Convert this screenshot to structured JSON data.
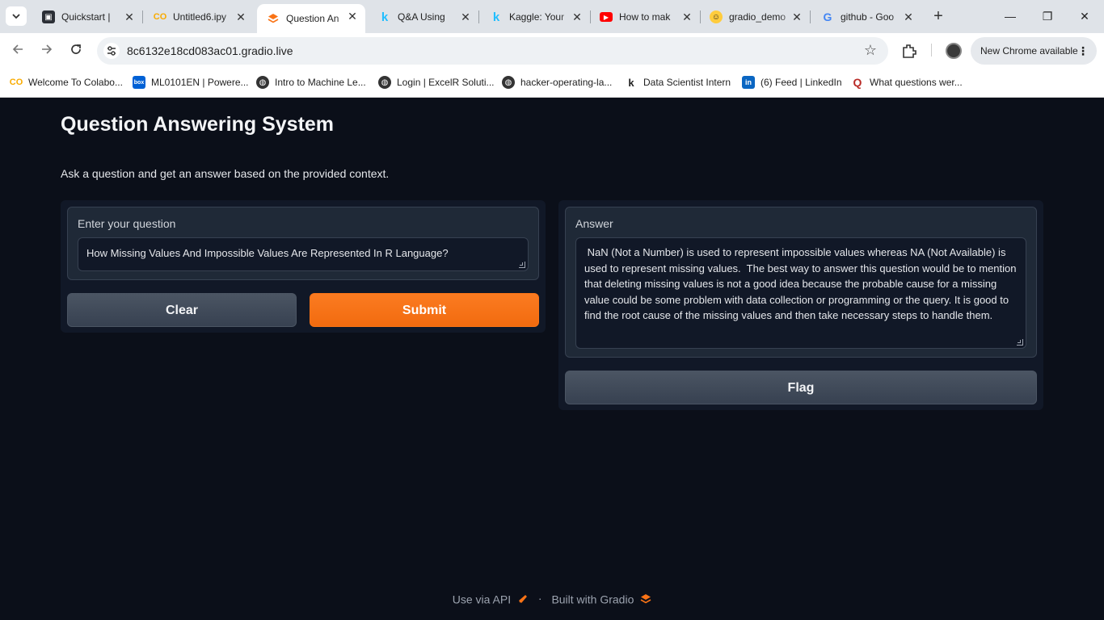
{
  "browser": {
    "tabs": [
      {
        "title": "Quickstart | ",
        "favicon": "colab"
      },
      {
        "title": "Untitled6.ipy",
        "favicon": "colab"
      },
      {
        "title": "Question An",
        "favicon": "gradio",
        "active": true
      },
      {
        "title": "Q&A Using",
        "favicon": "kaggle"
      },
      {
        "title": "Kaggle: Your",
        "favicon": "kaggle"
      },
      {
        "title": "How to mak",
        "favicon": "youtube"
      },
      {
        "title": "gradio_demo",
        "favicon": "huggingface"
      },
      {
        "title": "github - Goo",
        "favicon": "google"
      }
    ],
    "url": "8c6132e18cd083ac01.gradio.live",
    "update_label": "New Chrome available",
    "bookmarks": [
      {
        "label": "Welcome To Colabo...",
        "favicon": "colab"
      },
      {
        "label": "ML0101EN | Powere...",
        "favicon": "box"
      },
      {
        "label": "Intro to Machine Le...",
        "favicon": "globe"
      },
      {
        "label": "Login | ExcelR Soluti...",
        "favicon": "globe"
      },
      {
        "label": "hacker-operating-la...",
        "favicon": "globe"
      },
      {
        "label": "Data Scientist Intern",
        "favicon": "kaggle"
      },
      {
        "label": "(6) Feed | LinkedIn",
        "favicon": "linkedin"
      },
      {
        "label": "What questions wer...",
        "favicon": "quora"
      }
    ]
  },
  "app": {
    "title": "Question Answering System",
    "description": "Ask a question and get an answer based on the provided context.",
    "question_label": "Enter your question",
    "question_value": "How Missing Values And Impossible Values Are Represented In R Language?",
    "clear_label": "Clear",
    "submit_label": "Submit",
    "answer_label": "Answer",
    "answer_value": " NaN (Not a Number) is used to represent impossible values whereas NA (Not Available) is used to represent missing values.  The best way to answer this question would be to mention that deleting missing values is not a good idea because the probable cause for a missing value could be some problem with data collection or programming or the query. It is good to find the root cause of the missing values and then take necessary steps to handle them.",
    "flag_label": "Flag",
    "footer_api": "Use via API",
    "footer_sep": "·",
    "footer_built": "Built with Gradio"
  },
  "colors": {
    "background": "#0b0f19",
    "primary_button": "#f97316",
    "block": "#1f2937"
  }
}
